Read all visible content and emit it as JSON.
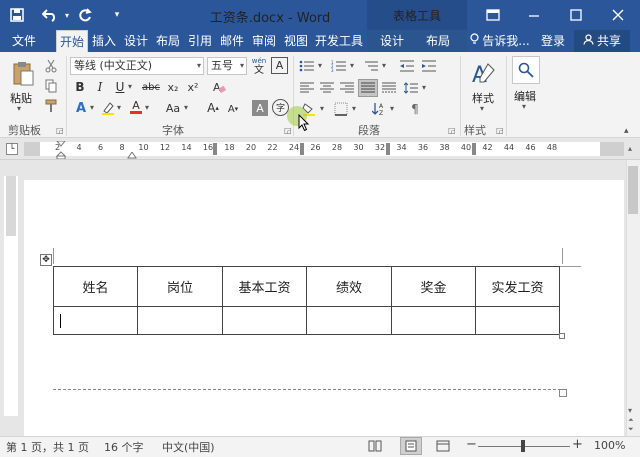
{
  "titlebar": {
    "title": "工资条.docx - Word",
    "context_tab_group": "表格工具",
    "icons": [
      "save-icon",
      "undo-icon",
      "redo-icon",
      "customize-qat-icon",
      "ribbon-display-icon",
      "minimize-icon",
      "maximize-icon",
      "close-icon"
    ],
    "color": "#2b579a"
  },
  "tabs": [
    "文件",
    "开始",
    "插入",
    "设计",
    "布局",
    "引用",
    "邮件",
    "审阅",
    "视图",
    "开发工具",
    "设计",
    "布局"
  ],
  "tell_me": "告诉我...",
  "login": "登录",
  "share": "共享",
  "ribbon": {
    "clipboard": {
      "paste": "粘贴",
      "label": "剪贴板"
    },
    "font": {
      "font_name": "等线 (中文正文)",
      "font_size": "五号",
      "wen": "wén",
      "wen_char": "文",
      "char_border": "A",
      "bold": "B",
      "italic": "I",
      "underline": "U",
      "strike": "abc",
      "sub": "x₂",
      "sup": "x²",
      "grow": "A",
      "shrink": "A",
      "case": "Aa",
      "highlight": "A",
      "font_color": "A",
      "shading": "A",
      "enclose": "字",
      "label": "字体"
    },
    "paragraph": {
      "label": "段落"
    },
    "styles": {
      "button": "样式",
      "label": "样式"
    },
    "editing": {
      "button": "编辑"
    }
  },
  "ruler": {
    "numbers": [
      "2",
      "2",
      "4",
      "6",
      "8",
      "10",
      "12",
      "14",
      "16",
      "18",
      "20",
      "22",
      "24",
      "26",
      "28",
      "30",
      "32",
      "34",
      "36",
      "38",
      "40",
      "42",
      "44",
      "46",
      "48"
    ]
  },
  "table": {
    "headers": [
      "姓名",
      "岗位",
      "基本工资",
      "绩效",
      "奖金",
      "实发工资"
    ],
    "rows": [
      [
        "",
        "",
        "",
        "",
        "",
        ""
      ]
    ]
  },
  "status": {
    "page": "第 1 页，共 1 页",
    "words": "16 个字",
    "language": "中文(中国)",
    "zoom": "100%",
    "zoom_out": "−",
    "zoom_in": "+"
  }
}
